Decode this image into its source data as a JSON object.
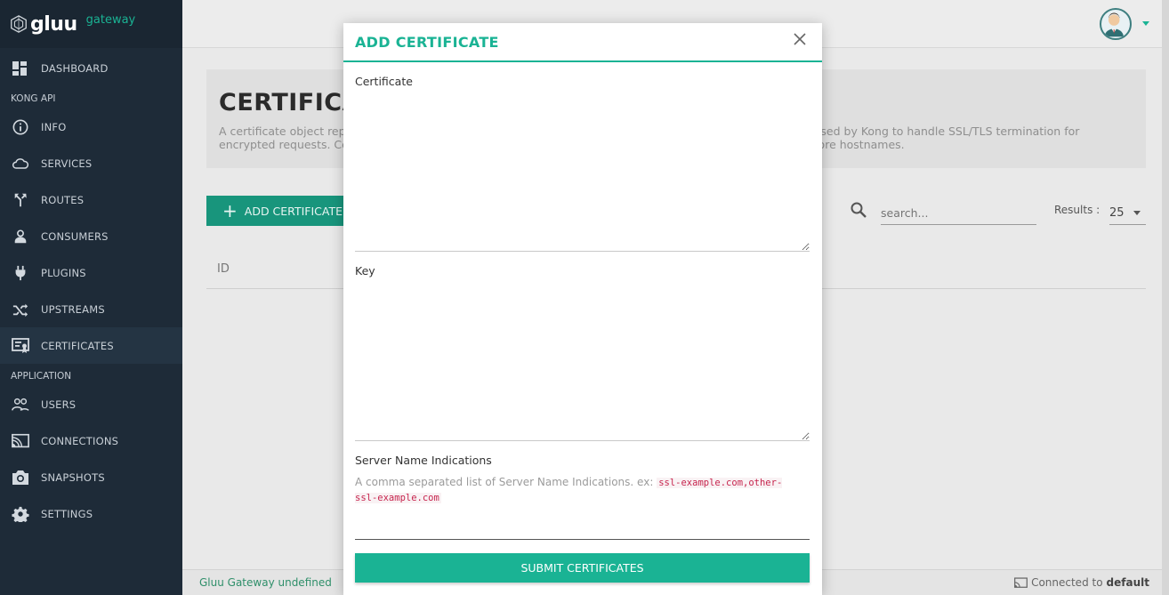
{
  "brand": {
    "name": "gluu",
    "subtitle": "gateway"
  },
  "sidebar": {
    "items": [
      {
        "label": "DASHBOARD",
        "icon": "dashboard-icon"
      },
      {
        "label": "INFO",
        "icon": "info-icon"
      },
      {
        "label": "SERVICES",
        "icon": "cloud-icon"
      },
      {
        "label": "ROUTES",
        "icon": "routes-icon"
      },
      {
        "label": "CONSUMERS",
        "icon": "user-icon"
      },
      {
        "label": "PLUGINS",
        "icon": "plug-icon"
      },
      {
        "label": "UPSTREAMS",
        "icon": "shuffle-icon"
      },
      {
        "label": "CERTIFICATES",
        "icon": "certificate-icon",
        "active": true
      },
      {
        "label": "USERS",
        "icon": "users-icon"
      },
      {
        "label": "CONNECTIONS",
        "icon": "cast-icon"
      },
      {
        "label": "SNAPSHOTS",
        "icon": "camera-icon"
      },
      {
        "label": "SETTINGS",
        "icon": "gear-icon"
      }
    ],
    "sections": {
      "kong_api": "KONG API",
      "application": "APPLICATION"
    }
  },
  "page": {
    "title": "CERTIFICATES",
    "description": "A certificate object represents a public certificate/private key pair for an SSL certificate. These objects are used by Kong to handle SSL/TLS termination for encrypted requests. Certificates are optionally associated with SNI objects to tie a cert/key pair to one or more hostnames."
  },
  "toolbar": {
    "add_label": "ADD CERTIFICATE",
    "search_placeholder": "search...",
    "results_label": "Results :",
    "results_value": "25"
  },
  "table": {
    "columns": [
      "ID"
    ]
  },
  "footer": {
    "left": "Gluu Gateway undefined",
    "connected_prefix": "Connected to",
    "connected_target": "default"
  },
  "modal": {
    "title": "ADD CERTIFICATE",
    "certificate_label": "Certificate",
    "key_label": "Key",
    "sni_label": "Server Name Indications",
    "sni_help": "A comma separated list of Server Name Indications. ex:",
    "sni_example": "ssl-example.com,other-ssl-example.com",
    "submit_label": "SUBMIT CERTIFICATES"
  },
  "colors": {
    "accent": "#1ab394",
    "sidebar": "#1e2b38",
    "code": "#c7254e"
  }
}
